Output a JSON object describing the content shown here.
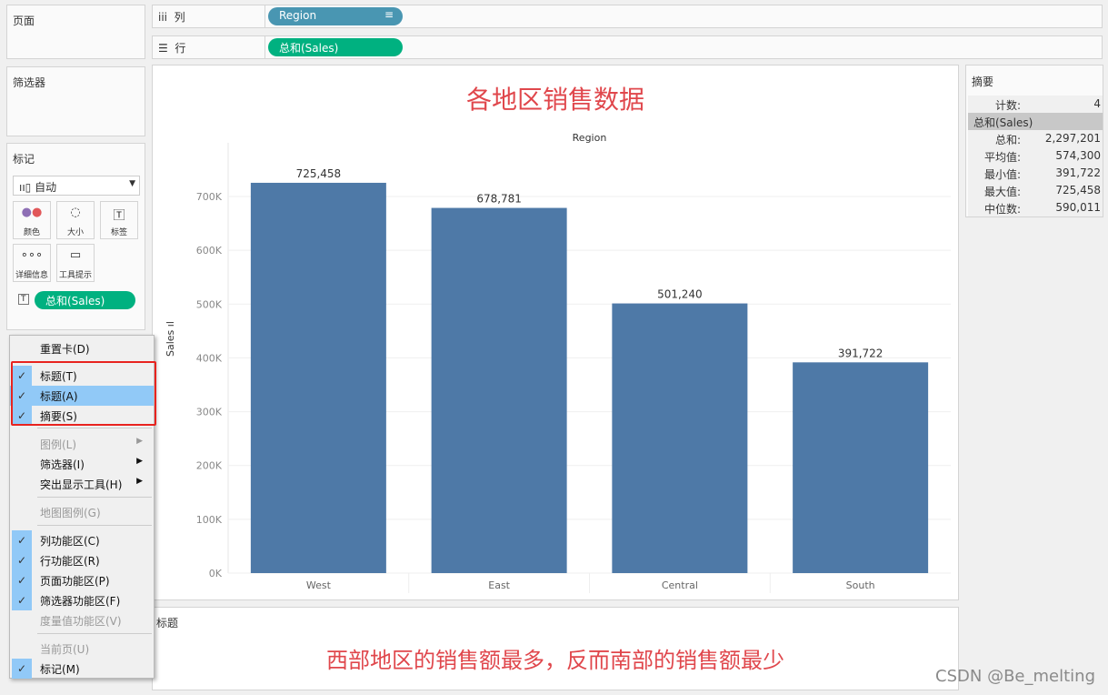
{
  "shelves": {
    "pages_label": "页面",
    "columns_label": "列",
    "rows_label": "行",
    "columns_pill": "Region",
    "rows_pill": "总和(Sales)",
    "filters_label": "筛选器"
  },
  "marks": {
    "title": "标记",
    "type": "自动",
    "buttons": [
      "颜色",
      "大小",
      "标签",
      "详细信息",
      "工具提示"
    ],
    "label_pill": "总和(Sales)"
  },
  "menu": {
    "items": [
      {
        "label": "重置卡(D)",
        "checked": false,
        "disabled": false
      },
      {
        "label": "标题(T)",
        "checked": true,
        "disabled": false
      },
      {
        "label": "标题(A)",
        "checked": true,
        "disabled": false,
        "highlighted": true
      },
      {
        "label": "摘要(S)",
        "checked": true,
        "disabled": false
      },
      {
        "label": "图例(L)",
        "checked": false,
        "disabled": true,
        "submenu": true
      },
      {
        "label": "筛选器(I)",
        "checked": false,
        "disabled": false,
        "submenu": true
      },
      {
        "label": "突出显示工具(H)",
        "checked": false,
        "disabled": false,
        "submenu": true
      },
      {
        "label": "地图图例(G)",
        "checked": false,
        "disabled": true
      },
      {
        "label": "列功能区(C)",
        "checked": true,
        "disabled": false
      },
      {
        "label": "行功能区(R)",
        "checked": true,
        "disabled": false
      },
      {
        "label": "页面功能区(P)",
        "checked": true,
        "disabled": false
      },
      {
        "label": "筛选器功能区(F)",
        "checked": true,
        "disabled": false
      },
      {
        "label": "度量值功能区(V)",
        "checked": false,
        "disabled": true
      },
      {
        "label": "当前页(U)",
        "checked": false,
        "disabled": true
      },
      {
        "label": "标记(M)",
        "checked": true,
        "disabled": false
      }
    ]
  },
  "summary": {
    "title": "摘要",
    "count_label": "计数:",
    "count": "4",
    "field": "总和(Sales)",
    "rows": [
      {
        "k": "总和:",
        "v": "2,297,201"
      },
      {
        "k": "平均值:",
        "v": "574,300"
      },
      {
        "k": "最小值:",
        "v": "391,722"
      },
      {
        "k": "最大值:",
        "v": "725,458"
      },
      {
        "k": "中位数:",
        "v": "590,011"
      }
    ]
  },
  "caption": {
    "label": "标题",
    "text": "西部地区的销售额最多，反而南部的销售额最少"
  },
  "watermark": "CSDN @Be_melting",
  "colors": {
    "bar": "#4e79a7",
    "pill_green": "#00b180",
    "pill_blue": "#4996b2",
    "title_red": "#e0474c",
    "menu_highlight": "#91c9f7"
  },
  "chart_data": {
    "type": "bar",
    "title": "各地区销售数据",
    "header": "Region",
    "ylabel": "Sales",
    "categories": [
      "West",
      "East",
      "Central",
      "South"
    ],
    "values": [
      725458,
      678781,
      501240,
      391722
    ],
    "data_labels": [
      "725,458",
      "678,781",
      "501,240",
      "391,722"
    ],
    "yticks": [
      "0K",
      "100K",
      "200K",
      "300K",
      "400K",
      "500K",
      "600K",
      "700K"
    ],
    "ylim": [
      0,
      750000
    ],
    "grid": true
  }
}
